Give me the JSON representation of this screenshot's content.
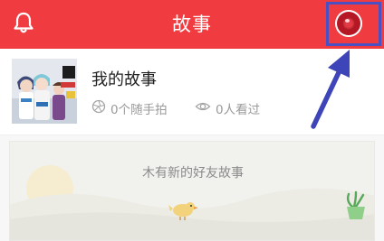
{
  "header": {
    "title": "故事",
    "bell_icon": "bell-icon",
    "avatar_icon": "profile-avatar-icon",
    "background": "#f03c41"
  },
  "story": {
    "title": "我的故事",
    "photos": {
      "label": "0个随手拍",
      "icon": "camera-shutter-icon"
    },
    "viewers": {
      "label": "0人看过",
      "icon": "eye-icon"
    }
  },
  "feed": {
    "empty_message": "木有新的好友故事"
  },
  "annotation": {
    "highlight_color": "#4a4fc1",
    "arrow_color": "#3d45b8"
  }
}
